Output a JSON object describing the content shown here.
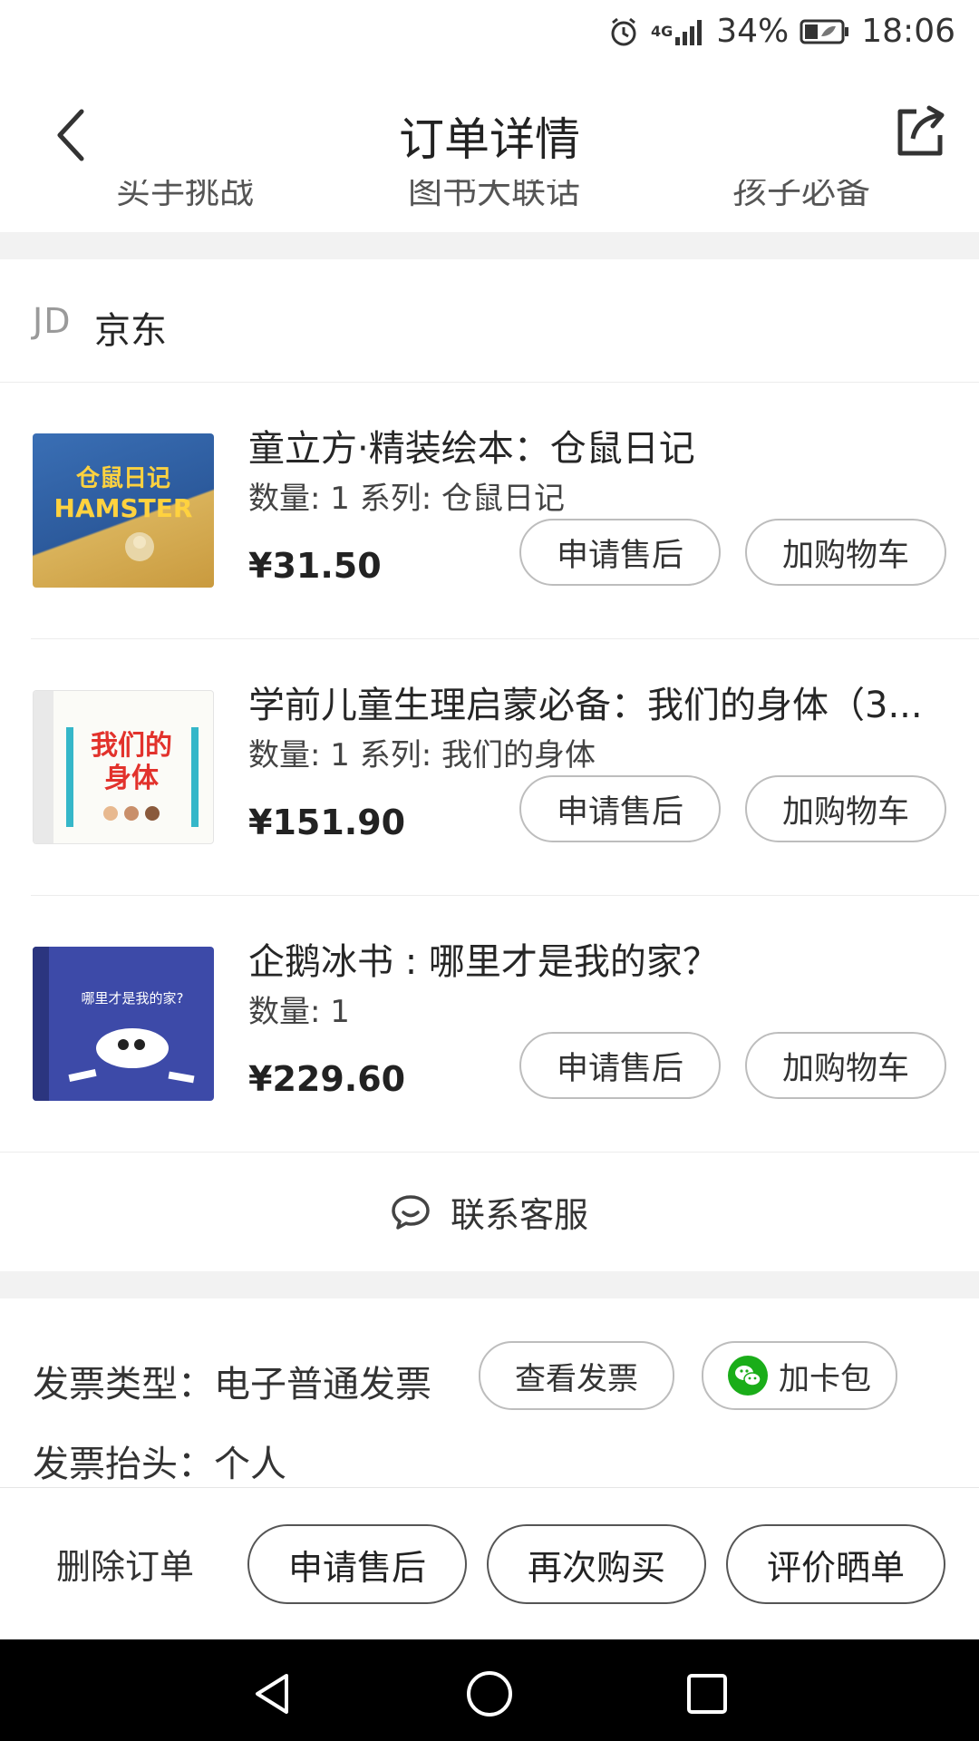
{
  "status_bar": {
    "network": "4G",
    "battery": "34%",
    "time": "18:06"
  },
  "nav": {
    "title": "订单详情"
  },
  "cut_row": {
    "left": "买手挑战",
    "center": "图书大联话",
    "right": "孩子必备"
  },
  "shop": {
    "logo": "JD",
    "name": "京东"
  },
  "items": [
    {
      "title": "童立方·精装绘本：仓鼠日记",
      "meta": "数量: 1 系列: 仓鼠日记",
      "price": "¥31.50",
      "aftersale": "申请售后",
      "addcart": "加购物车",
      "cover_text": "仓鼠日记",
      "cover_text2": "HAMSTER"
    },
    {
      "title": "学前儿童生理启蒙必备：我们的身体（3...",
      "meta": "数量: 1 系列: 我们的身体",
      "price": "¥151.90",
      "aftersale": "申请售后",
      "addcart": "加购物车",
      "cover_text": "我们的",
      "cover_text2": "身体"
    },
    {
      "title": "企鹅冰书 : 哪里才是我的家？",
      "meta": "数量: 1",
      "price": "¥229.60",
      "aftersale": "申请售后",
      "addcart": "加购物车",
      "cover_text": "哪里才是我的家?",
      "cover_text2": ""
    }
  ],
  "contact": {
    "label": "联系客服"
  },
  "invoice": {
    "type_label": "发票类型：电子普通发票",
    "view_label": "查看发票",
    "wallet_label": "加卡包",
    "title_label": "发票抬头：个人"
  },
  "actions": {
    "delete": "删除订单",
    "aftersale": "申请售后",
    "rebuy": "再次购买",
    "review": "评价晒单"
  },
  "colors": {
    "wechat_green": "#1aad19",
    "gap_gray": "#f2f2f2"
  }
}
